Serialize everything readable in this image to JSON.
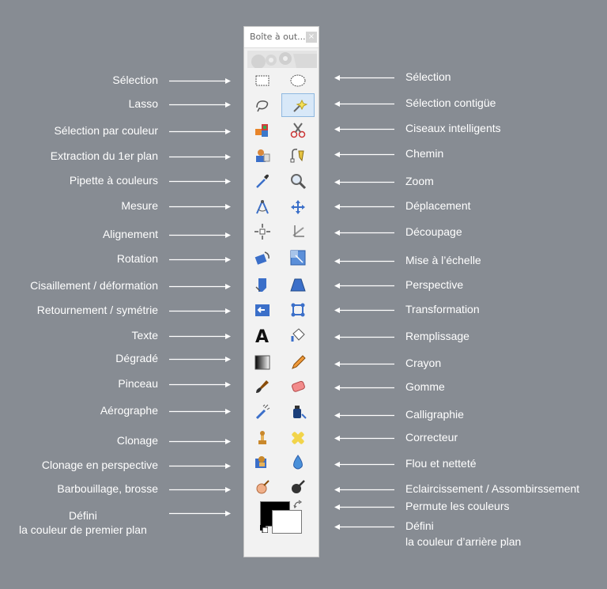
{
  "window": {
    "title": "Boîte à out...",
    "close_glyph": "×"
  },
  "left_labels": [
    "Sélection",
    "Lasso",
    "Sélection par couleur",
    "Extraction du 1er plan",
    "Pipette à couleurs",
    "Mesure",
    "Alignement",
    "Rotation",
    "Cisaillement / déformation",
    "Retournement / symétrie",
    "Texte",
    "Dégradé",
    "Pinceau",
    "Aérographe",
    "Clonage",
    "Clonage en perspective",
    "Barbouillage, brosse"
  ],
  "left_last": {
    "line1": "Défini",
    "line2": "la couleur de premier plan"
  },
  "right_labels": [
    "Sélection",
    "Sélection contigüe",
    "Ciseaux intelligents",
    "Chemin",
    "Zoom",
    "Déplacement",
    "Découpage",
    "Mise à l’échelle",
    "Perspective",
    "Transformation",
    "Remplissage",
    "Crayon",
    "Gomme",
    "Calligraphie",
    "Correcteur",
    "Flou et netteté",
    "Eclaircissement / Assombirssement",
    "Permute les couleurs"
  ],
  "right_last": {
    "line1": "Défini",
    "line2": "la couleur d’arrière plan"
  },
  "left_tools": [
    "rect-select-icon",
    "lasso-icon",
    "select-by-color-icon",
    "foreground-extract-icon",
    "color-picker-icon",
    "measure-icon",
    "align-icon",
    "rotate-icon",
    "shear-icon",
    "flip-icon",
    "text-icon",
    "gradient-icon",
    "paintbrush-icon",
    "airbrush-icon",
    "clone-icon",
    "perspective-clone-icon",
    "smudge-icon"
  ],
  "right_tools": [
    "ellipse-select-icon",
    "fuzzy-select-icon",
    "scissors-icon",
    "paths-icon",
    "zoom-icon",
    "move-icon",
    "crop-icon",
    "scale-icon",
    "perspective-icon",
    "unified-transform-icon",
    "bucket-fill-icon",
    "pencil-icon",
    "eraser-icon",
    "ink-icon",
    "heal-icon",
    "blur-sharpen-icon",
    "dodge-burn-icon"
  ],
  "active_tool": "fuzzy-select-icon",
  "colors": {
    "background": "#878c93",
    "foreground_color": "#000000",
    "background_color": "#ffffff",
    "label_text": "#ffffff"
  }
}
